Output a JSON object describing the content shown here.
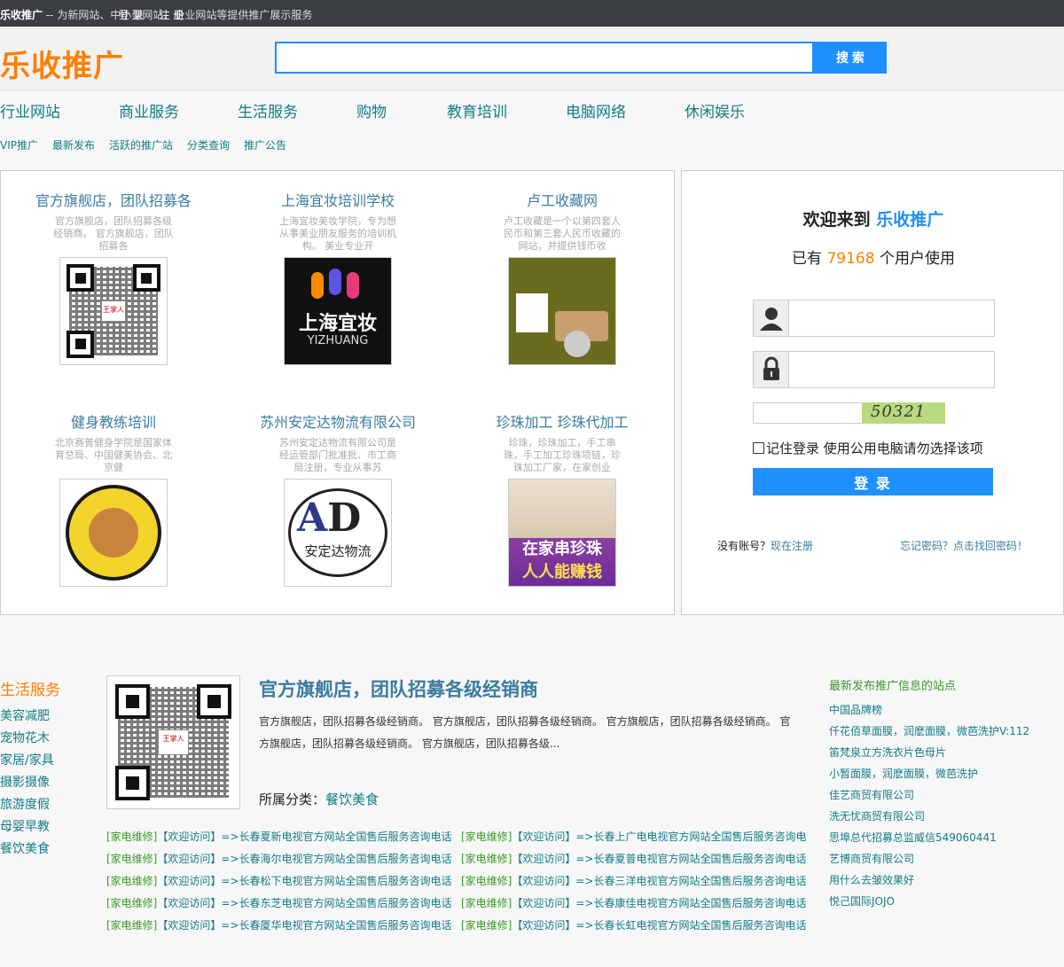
{
  "topbar": {
    "site_name": "乐收推广",
    "tagline": "-- 为新网站、中小型网站、企业网站等提供推广展示服务",
    "login": "登 录",
    "register": "注 册"
  },
  "header": {
    "logo": "乐收推广",
    "search_button": "搜 索",
    "search_placeholder": ""
  },
  "nav": [
    "行业网站",
    "商业服务",
    "生活服务",
    "购物",
    "教育培训",
    "电脑网络",
    "休闲娱乐"
  ],
  "subnav": [
    "VIP推广",
    "最新发布",
    "活跃的推广站",
    "分类查询",
    "推广公告"
  ],
  "cards": [
    {
      "title": "官方旗舰店，团队招募各",
      "desc": "官方旗舰店，团队招募各级经销商。 官方旗舰店，团队招募各",
      "image": "qr-code"
    },
    {
      "title": "上海宜妆培训学校",
      "desc": "上海宜妆美妆学院，专为想从事美业朋友服务的培训机构。 美业专业开",
      "image": "logo-yizhuang",
      "image_text": "上海宜妆",
      "image_sub": "YIZHUANG"
    },
    {
      "title": "卢工收藏网",
      "desc": "卢工收藏是一个以第四套人民币和第三套人民币收藏的网站，并提供钱币收",
      "image": "collection-photo"
    },
    {
      "title": "健身教练培训",
      "desc": "北京赛普健身学院是国家体育总局、中国健美协会、北京健",
      "image": "fitness-seal"
    },
    {
      "title": "苏州安定达物流有限公司",
      "desc": "苏州安定达物流有限公司是经运管部门批准批、市工商局注册，专业从事苏",
      "image": "logo-add",
      "image_text": "安定达物流"
    },
    {
      "title": "珍珠加工 珍珠代加工",
      "desc": "珍珠，珍珠加工，手工串珠，手工加工珍珠项链，珍珠加工厂家，在家创业",
      "image": "pearl-photo",
      "image_text": "在家串珍珠",
      "image_sub": "人人能赚钱"
    }
  ],
  "login": {
    "welcome_prefix": "欢迎来到 ",
    "welcome_brand": "乐收推广",
    "users_prefix": "已有 ",
    "users_count": "79168",
    "users_suffix": " 个用户使用",
    "captcha": "50321",
    "remember": "记住登录 使用公用电脑请勿选择该项",
    "login_button": "登 录",
    "no_account": "没有账号？",
    "register_now": "现在注册",
    "forgot": "忘记密码？点击找回密码！"
  },
  "lower": {
    "category_title": "生活服务",
    "categories": [
      "美容减肥",
      "宠物花木",
      "家居/家具",
      "摄影摄像",
      "旅游度假",
      "母婴早教",
      "餐饮美食"
    ],
    "feature_title": "官方旗舰店，团队招募各级经销商",
    "feature_desc": "官方旗舰店，团队招募各级经销商。 官方旗舰店，团队招募各级经销商。 官方旗舰店，团队招募各级经销商。 官方旗舰店，团队招募各级经销商。 官方旗舰店，团队招募各级...",
    "feature_cat_label": "所属分类：",
    "feature_cat": "餐饮美食",
    "links": [
      [
        "[家电维修]",
        "【欢迎访问】=>长春夏新电视官方网站全国售后服务咨询电话",
        "[家电维修]",
        "【欢迎访问】=>长春上广电电视官方网站全国售后服务咨询电"
      ],
      [
        "[家电维修]",
        "【欢迎访问】=>长春海尔电视官方网站全国售后服务咨询电话",
        "[家电维修]",
        "【欢迎访问】=>长春夏普电视官方网站全国售后服务咨询电话"
      ],
      [
        "[家电维修]",
        "【欢迎访问】=>长春松下电视官方网站全国售后服务咨询电话",
        "[家电维修]",
        "【欢迎访问】=>长春三洋电视官方网站全国售后服务咨询电话"
      ],
      [
        "[家电维修]",
        "【欢迎访问】=>长春东芝电视官方网站全国售后服务咨询电话",
        "[家电维修]",
        "【欢迎访问】=>长春康佳电视官方网站全国售后服务咨询电话"
      ],
      [
        "[家电维修]",
        "【欢迎访问】=>长春厦华电视官方网站全国售后服务咨询电话",
        "[家电维修]",
        "【欢迎访问】=>长春长虹电视官方网站全国售后服务咨询电话"
      ]
    ],
    "latest_title": "最新发布推广信息的站点",
    "latest": [
      "中国品牌榜",
      "仟花佰草面膜，润麽面膜，微芭洗护V:112",
      "笛梵泉立方洗衣片色母片",
      "小暂面膜，润麽面膜，微芭洗护",
      "佳艺商贸有限公司",
      "洗无忧商贸有限公司",
      "思埠总代招募总监威信549060441",
      "艺博商贸有限公司",
      "用什么去皱效果好",
      "悦己国际JOJO"
    ]
  },
  "colors": {
    "accent": "#1e90ff",
    "brand": "#ff7f00",
    "link": "#117c87",
    "tag": "#3a9a28"
  }
}
